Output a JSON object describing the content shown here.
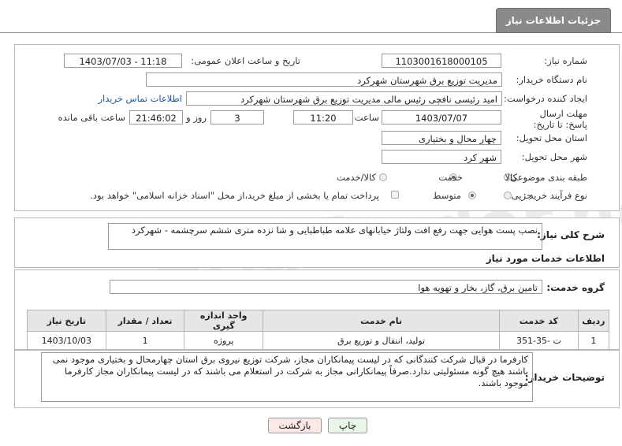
{
  "header": {
    "title": "جزئیات اطلاعات نیاز"
  },
  "form": {
    "need_number_label": "شماره نیاز:",
    "need_number": "1103001618000105",
    "announce_label": "تاریخ و ساعت اعلان عمومی:",
    "announce_value": "1403/07/03 - 11:18",
    "buyer_org_label": "نام دستگاه خریدار:",
    "buyer_org": "مدیریت توزیع برق شهرستان شهرکرد",
    "creator_label": "ایجاد کننده درخواست:",
    "creator": "امید رئیسی نافچی رئیس مالی مدیریت توزیع برق شهرستان شهرکرد",
    "contact_link": "اطلاعات تماس خریدار",
    "deadline_label": "مهلت ارسال پاسخ: تا تاریخ:",
    "deadline_date": "1403/07/07",
    "time_label": "ساعت",
    "deadline_time": "11:20",
    "days_value": "3",
    "days_label": "روز و",
    "remaining_time": "21:46:02",
    "remaining_label": "ساعت باقی مانده",
    "province_label": "استان محل تحویل:",
    "province": "چهار محال و بختیاری",
    "city_label": "شهر محل تحویل:",
    "city": "شهر کرد",
    "category_label": "طبقه بندی موضوعی:",
    "category_options": [
      "کالا",
      "خدمت",
      "کالا/خدمت"
    ],
    "process_label": "نوع فرآیند خرید :",
    "process_options": [
      "جزیی",
      "متوسط"
    ],
    "payment_note": "پرداخت تمام یا بخشی از مبلغ خرید،از محل \"اسناد خزانه اسلامی\" خواهد بود."
  },
  "description": {
    "label": "شرح کلی نیاز:",
    "text": "نصب پست هوایی جهت رفع افت ولتاژ خیابانهای علامه طباطبایی و شا نزده متری ششم سرچشمه - شهرکرد"
  },
  "services": {
    "section_title": "اطلاعات خدمات مورد نیاز",
    "group_label": "گروه خدمت:",
    "group_value": "تامین برق، گاز، بخار و تهویه هوا",
    "columns": [
      "ردیف",
      "کد خدمت",
      "نام خدمت",
      "واحد اندازه گیری",
      "تعداد / مقدار",
      "تاریخ نیاز"
    ],
    "rows": [
      {
        "row": "1",
        "code": "ت -35-351",
        "name": "تولید، انتقال و توزیع برق",
        "unit": "پروژه",
        "qty": "1",
        "date": "1403/10/03"
      }
    ]
  },
  "buyer_notes": {
    "label": "توضیحات خریدار:",
    "text": "کارفرما در قبال شرکت کنندگانی که در لیست پیمانکاران مجاز، شرکت توزیع نیروی برق استان چهارمحال و بختیاری موجود نمی باشند هیچ گونه مسئولیتی ندارد.صرفاً پیمانکارانی مجاز به شرکت در استعلام می باشند که در لیست پیمانکاران مجاز کارفرما موجود باشند."
  },
  "buttons": {
    "print": "چاپ",
    "back": "بازگشت"
  },
  "watermark": "AriaTender.neT",
  "colors": {
    "title_bg": "#8a8a8a",
    "link": "#1a57b5",
    "back_btn_bg": "#fde8e8",
    "print_btn_bg": "#eaf6ea"
  }
}
